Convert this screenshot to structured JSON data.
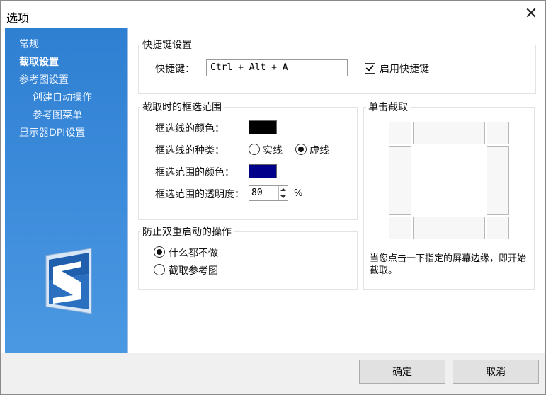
{
  "window": {
    "title": "选项",
    "close_icon": "close-icon"
  },
  "sidebar": {
    "items": [
      {
        "label": "常规",
        "active": false
      },
      {
        "label": "截取设置",
        "active": true
      },
      {
        "label": "参考图设置",
        "active": false
      },
      {
        "label": "创建自动操作",
        "active": false
      },
      {
        "label": "参考图菜单",
        "active": false
      },
      {
        "label": "显示器DPI设置",
        "active": false
      }
    ],
    "logo_icon": "app-logo-icon"
  },
  "hotkey": {
    "group_title": "快捷键设置",
    "label": "快捷键：",
    "value": "Ctrl + Alt + A",
    "enable_label": "启用快捷键",
    "enabled": true
  },
  "frame": {
    "group_title": "截取时的框选范围",
    "line_color_label": "框选线的颜色：",
    "line_color": "#000000",
    "line_type_label": "框选线的种类：",
    "line_type_options": [
      "实线",
      "虚线"
    ],
    "line_type_selected": "虚线",
    "area_color_label": "框选范围的颜色：",
    "area_color": "#00008b",
    "opacity_label": "框选范围的透明度：",
    "opacity_value": "80",
    "opacity_unit": "%"
  },
  "double_start": {
    "group_title": "防止双重启动的操作",
    "options": [
      "什么都不做",
      "截取参考图"
    ],
    "selected": "什么都不做"
  },
  "single_click": {
    "group_title": "单击截取",
    "note": "当您点击一下指定的屏幕边缘，即开始截取。"
  },
  "footer": {
    "ok_label": "确定",
    "cancel_label": "取消"
  }
}
